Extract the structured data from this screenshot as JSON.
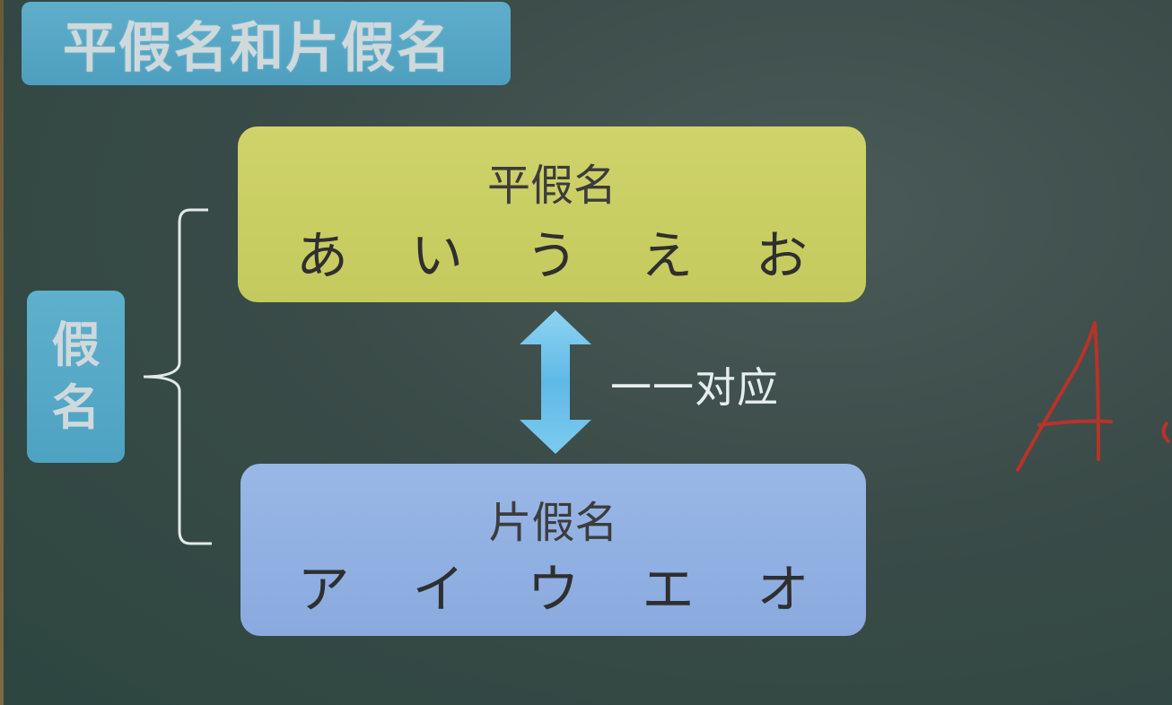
{
  "title": "平假名和片假名",
  "side_label": [
    "假",
    "名"
  ],
  "hiragana_box": {
    "title": "平假名",
    "chars": [
      "あ",
      "い",
      "う",
      "え",
      "お"
    ]
  },
  "katakana_box": {
    "title": "片假名",
    "chars": [
      "ア",
      "イ",
      "ウ",
      "エ",
      "オ"
    ]
  },
  "correspondence_label": "一一对应",
  "colors": {
    "board": "#3a4b48",
    "tag": "#56a8c7",
    "hiragana_box": "#c9ce62",
    "katakana_box": "#91b0e2",
    "arrow": "#6cc4ec",
    "handwriting": "#c0392b"
  },
  "icons": {
    "brace": "left-curly-brace-icon",
    "arrow": "double-vertical-arrow-icon",
    "handwriting": "handwritten-letter-icon"
  }
}
